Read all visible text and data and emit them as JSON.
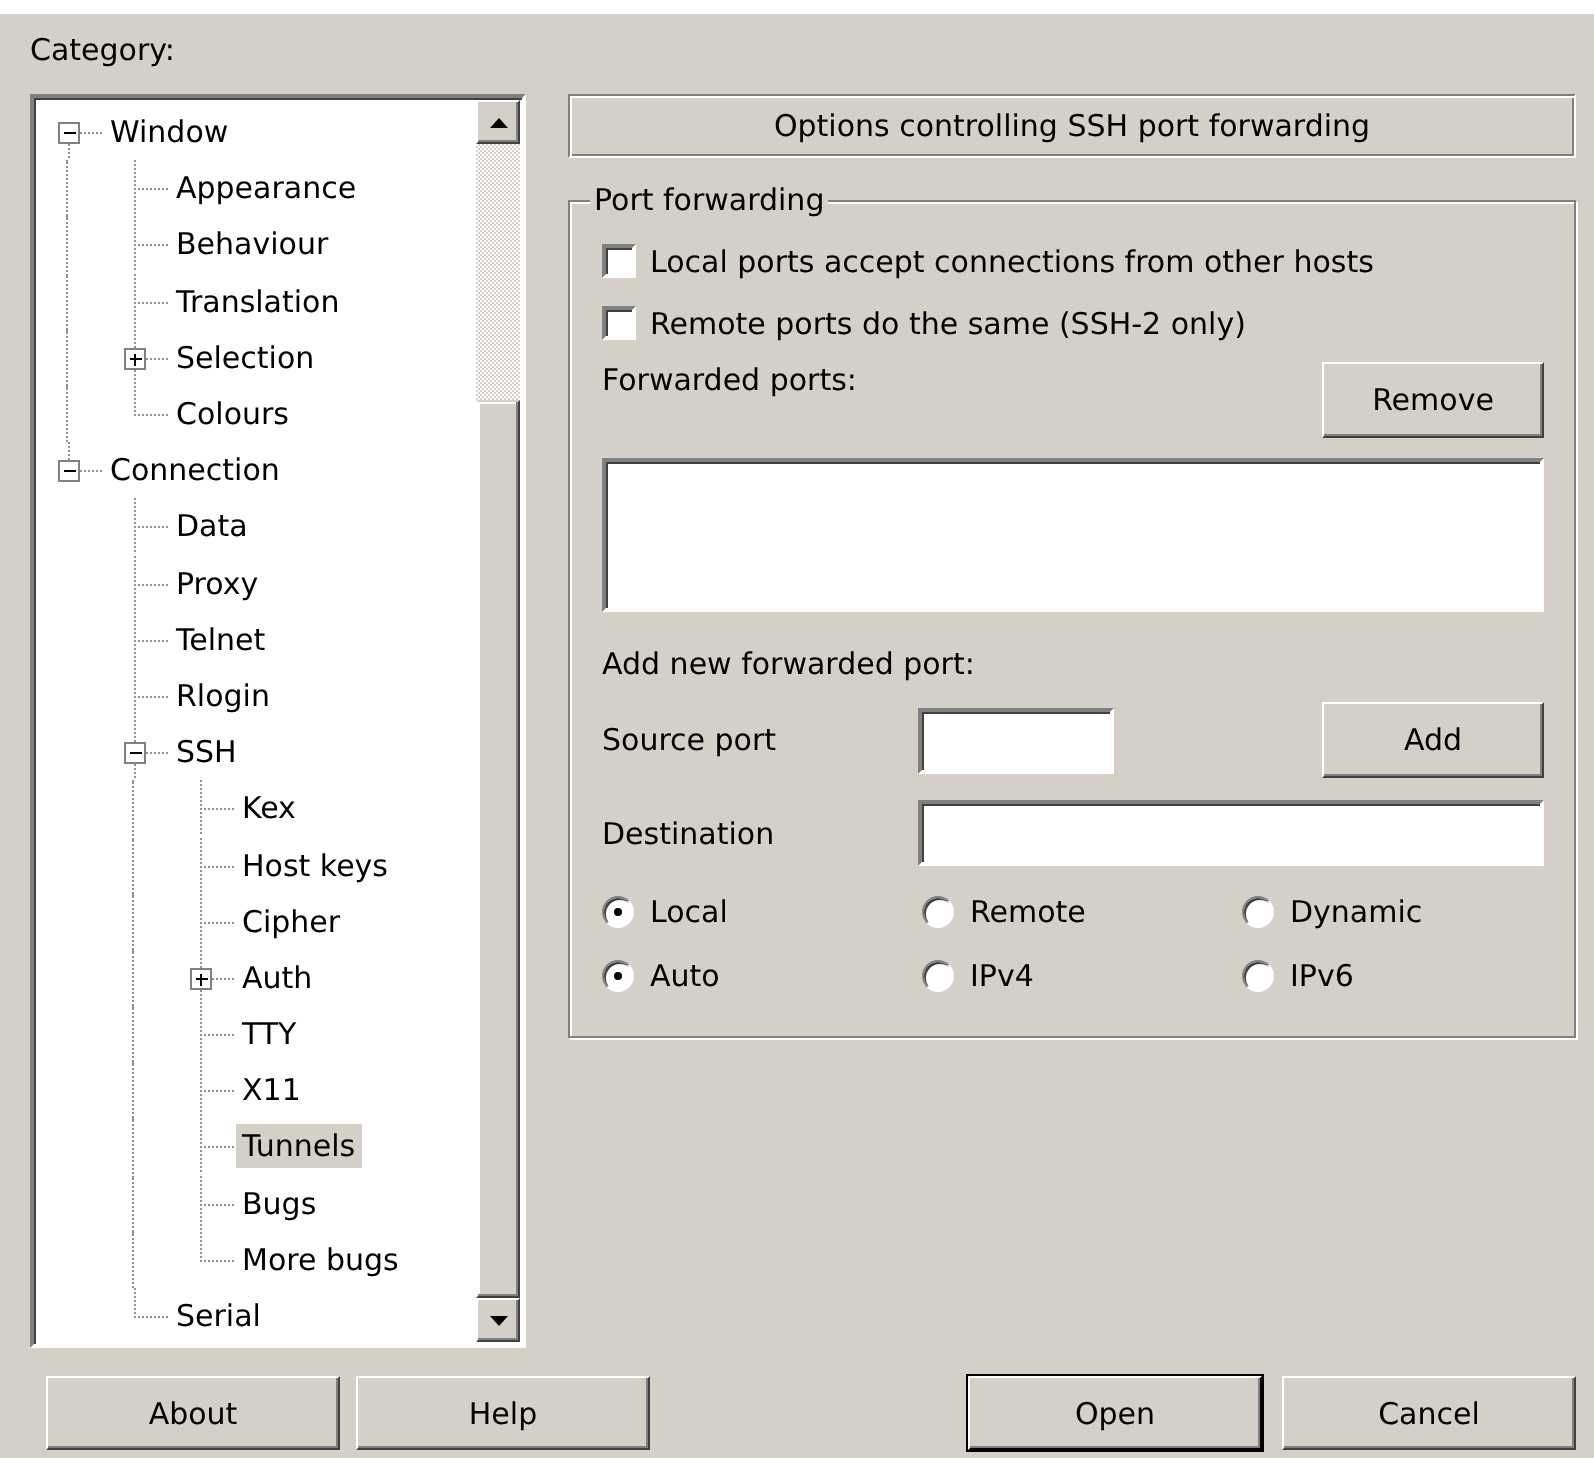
{
  "category_label": "Category:",
  "tree": [
    {
      "label": "Window",
      "expanded": true,
      "selected": false,
      "children": [
        {
          "label": "Appearance",
          "selected": false
        },
        {
          "label": "Behaviour",
          "selected": false
        },
        {
          "label": "Translation",
          "selected": false
        },
        {
          "label": "Selection",
          "expanded": false,
          "selected": false
        },
        {
          "label": "Colours",
          "selected": false
        }
      ]
    },
    {
      "label": "Connection",
      "expanded": true,
      "selected": false,
      "children": [
        {
          "label": "Data",
          "selected": false
        },
        {
          "label": "Proxy",
          "selected": false
        },
        {
          "label": "Telnet",
          "selected": false
        },
        {
          "label": "Rlogin",
          "selected": false
        },
        {
          "label": "SSH",
          "expanded": true,
          "selected": false,
          "children": [
            {
              "label": "Kex",
              "selected": false
            },
            {
              "label": "Host keys",
              "selected": false
            },
            {
              "label": "Cipher",
              "selected": false
            },
            {
              "label": "Auth",
              "expanded": false,
              "selected": false
            },
            {
              "label": "TTY",
              "selected": false
            },
            {
              "label": "X11",
              "selected": false
            },
            {
              "label": "Tunnels",
              "selected": true
            },
            {
              "label": "Bugs",
              "selected": false
            },
            {
              "label": "More bugs",
              "selected": false
            }
          ]
        },
        {
          "label": "Serial",
          "selected": false
        }
      ]
    }
  ],
  "header": "Options controlling SSH port forwarding",
  "port_forwarding": {
    "title": "Port forwarding",
    "options": [
      {
        "label": "Local ports accept connections from other hosts",
        "checked": false
      },
      {
        "label": "Remote ports do the same (SSH-2 only)",
        "checked": false
      }
    ],
    "forwarded_ports_label": "Forwarded ports:",
    "remove_button": "Remove",
    "add_label": "Add new forwarded port:",
    "source_port_label": "Source port",
    "add_button": "Add",
    "destination_label": "Destination",
    "direction": [
      {
        "label": "Local",
        "selected": true
      },
      {
        "label": "Remote",
        "selected": false
      },
      {
        "label": "Dynamic",
        "selected": false
      }
    ],
    "ip_version": [
      {
        "label": "Auto",
        "selected": true
      },
      {
        "label": "IPv4",
        "selected": false
      },
      {
        "label": "IPv6",
        "selected": false
      }
    ]
  },
  "buttons_left": [
    {
      "label": "About",
      "default": false
    },
    {
      "label": "Help",
      "default": false
    }
  ],
  "buttons_right": [
    {
      "label": "Open",
      "default": true
    },
    {
      "label": "Cancel",
      "default": false
    }
  ]
}
